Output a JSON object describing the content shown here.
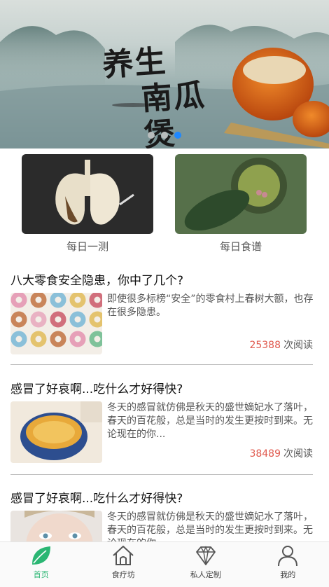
{
  "banner": {
    "title_line1": "养生",
    "title_line2": "南瓜煲",
    "dots": [
      false,
      false,
      true
    ]
  },
  "quick_links": [
    {
      "label": "每日一测"
    },
    {
      "label": "每日食谱"
    }
  ],
  "articles": [
    {
      "title": "八大零食安全隐患，你中了几个?",
      "desc": "即使很多标榜“安全”的零食村上春树大额，也存在很多隐患。",
      "reads": "25388",
      "reads_suffix": "次阅读"
    },
    {
      "title": "感冒了好哀啊...吃什么才好得快?",
      "desc": "冬天的感冒就仿佛是秋天的盛世嫡妃水了落叶，春天的百花般，总是当时的发生更按时到来。无论现在的你...",
      "reads": "38489",
      "reads_suffix": "次阅读"
    },
    {
      "title": "感冒了好哀啊...吃什么才好得快?",
      "desc": "冬天的感冒就仿佛是秋天的盛世嫡妃水了落叶，春天的百花般，总是当时的发生更按时到来。无论现在的你...",
      "reads": "",
      "reads_suffix": ""
    }
  ],
  "tabbar": [
    {
      "label": "首页",
      "icon": "leaf-icon",
      "active": true
    },
    {
      "label": "食疗坊",
      "icon": "home-icon",
      "active": false
    },
    {
      "label": "私人定制",
      "icon": "diamond-icon",
      "active": false
    },
    {
      "label": "我的",
      "icon": "user-icon",
      "active": false
    }
  ],
  "colors": {
    "accent": "#2bb673",
    "dot_active": "#1e88ff",
    "read_count": "#e05a4f"
  }
}
